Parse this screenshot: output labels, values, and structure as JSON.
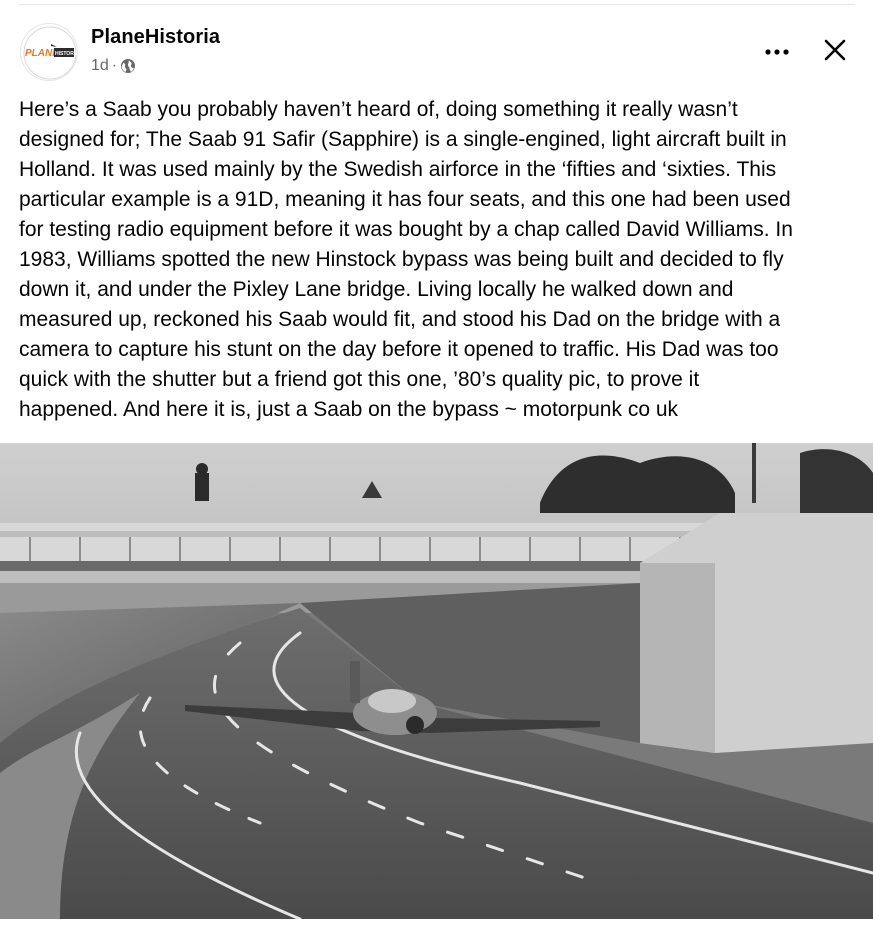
{
  "post": {
    "author": "PlaneHistoria",
    "time": "1d",
    "separator": "·",
    "avatar_logo_text": "PLANE HISTORIA",
    "body": "Here’s a Saab you probably haven’t heard of, doing something it really wasn’t\ndesigned for; The Saab 91 Safir (Sapphire) is a single-engined, light aircraft built in\nHolland. It was used mainly by the Swedish airforce in the ‘fifties and ‘sixties. This\nparticular example is a 91D, meaning it has four seats, and this one had been used\nfor testing radio equipment before it was bought by a chap called David Williams. In\n1983, Williams spotted the new Hinstock bypass was being built and decided to fly\ndown it, and under the Pixley Lane bridge. Living locally he walked down and\nmeasured up, reckoned his Saab would fit, and stood his Dad on the bridge with a\ncamera to capture his stunt on the day before it opened to traffic. His Dad was too\nquick with the shutter but a friend got this one, ’80’s quality pic, to prove it\nhappened. And here it is, just a Saab on the bypass ~ motorpunk co uk"
  },
  "icons": {
    "audience": "globe-icon",
    "more": "more-options-icon",
    "close": "close-icon"
  },
  "colors": {
    "text_primary": "#050505",
    "text_secondary": "#65676b",
    "logo_orange": "#f07a1a"
  }
}
